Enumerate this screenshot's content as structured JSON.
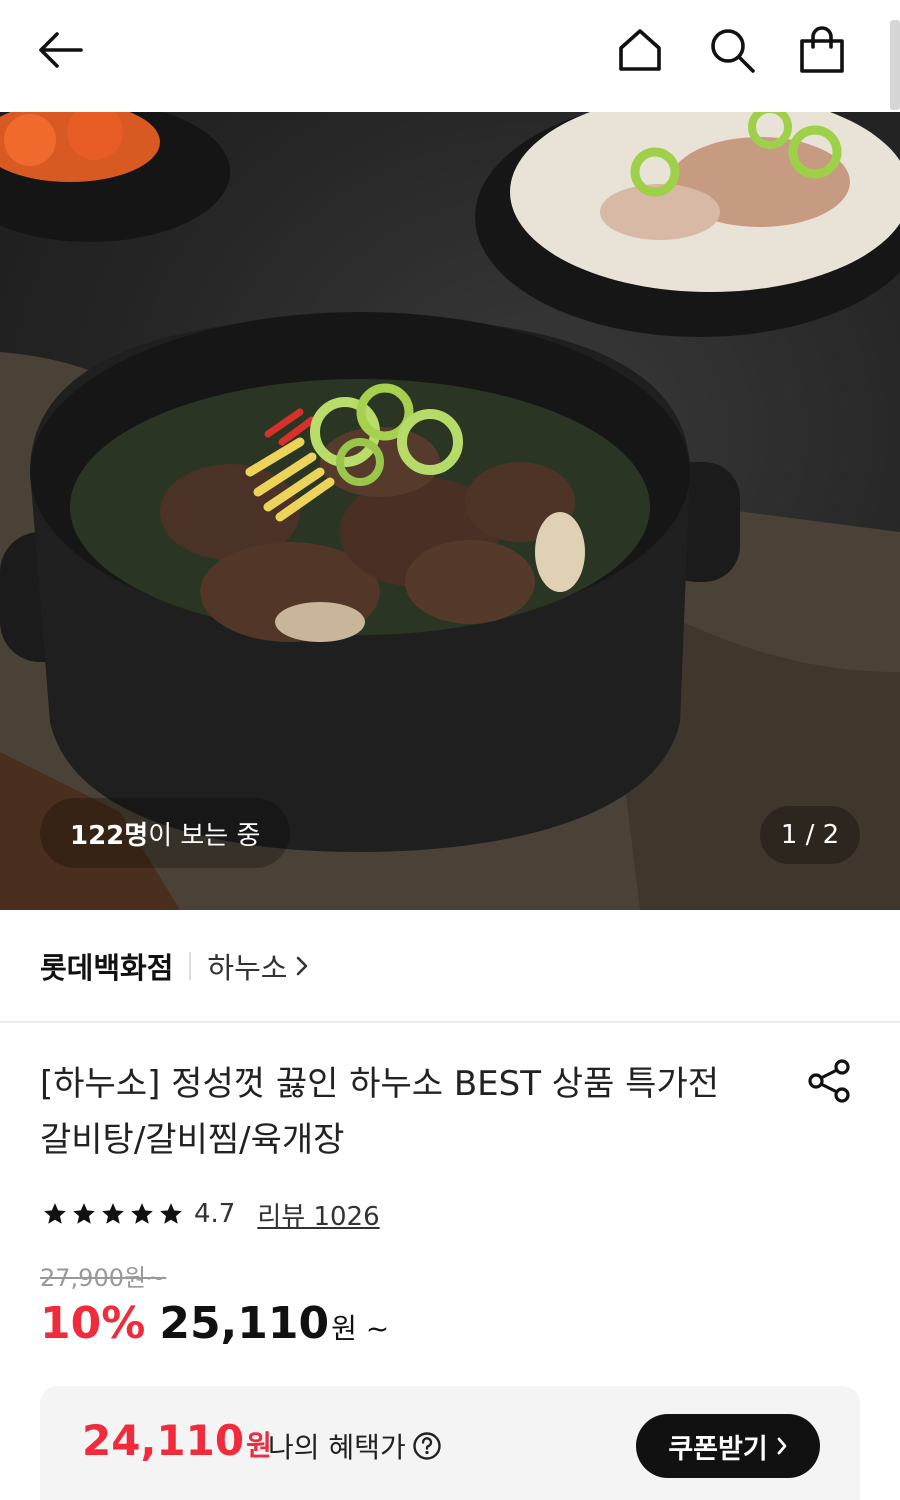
{
  "icons": {
    "back": "back-arrow-icon",
    "home": "home-icon",
    "search": "search-icon",
    "bag": "shopping-bag-icon",
    "share": "share-icon",
    "star": "star-icon",
    "help": "question-circle-icon"
  },
  "gallery": {
    "viewers_count": "122명",
    "viewers_text": "이 보는 중",
    "counter": "1 / 2"
  },
  "product": {
    "brand": "롯데백화점",
    "sub_brand": "하누소",
    "title": "[하누소] 정성껏 끓인 하누소 BEST 상품 특가전 갈비탕/갈비찜/육개장",
    "rating": {
      "stars": 5,
      "score": "4.7",
      "review_label": "리뷰 1026"
    },
    "original_price": "27,900원~",
    "discount": "10%",
    "price": "25,110",
    "price_unit": "원 ~"
  },
  "benefit": {
    "price": "24,110",
    "unit": "원",
    "label": "나의 혜택가",
    "coupon_button": "쿠폰받기"
  },
  "colors": {
    "accent_red": "#ef2b3c",
    "dark": "#111111"
  }
}
